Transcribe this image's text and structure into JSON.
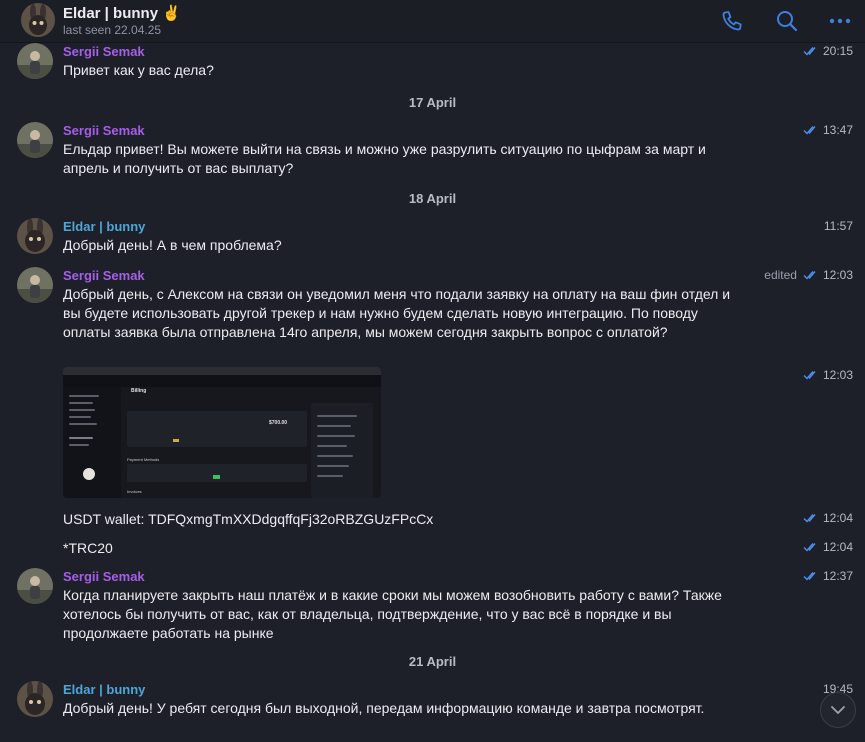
{
  "header": {
    "title": "Eldar | bunny ✌",
    "subtitle": "last seen 22.04.25",
    "icons": [
      "phone-icon",
      "search-icon",
      "more-icon"
    ]
  },
  "colors": {
    "accent": "#3d7fe0",
    "sergii": "#a55ee8",
    "eldar": "#4ea6d6",
    "background": "#1e2029"
  },
  "messages": [
    {
      "sender": "Sergii Semak",
      "text": "Привет как у вас дела?",
      "time": "20:15"
    },
    {
      "sender": "Sergii Semak",
      "text": "Ельдар привет! Вы можете выйти на связь и можно уже разрулить ситуацию по цыфрам за март и апрель и получить от вас выплату?",
      "time": "13:47"
    },
    {
      "sender": "Eldar | bunny",
      "text": "Добрый день! А в чем проблема?",
      "time": "11:57"
    },
    {
      "sender": "Sergii Semak",
      "text": "Добрый день, с Алексом на связи он уведомил меня что подали заявку на оплату на ваш фин отдел и вы будете использовать другой трекер и нам нужно будем сделать новую интеграцию. По поводу оплаты заявка была отправлена 14го апреля, мы можем сегодня закрыть вопрос с оплатой?",
      "time": "12:03",
      "edited": "edited"
    },
    {
      "image_time": "12:03",
      "image_text": {
        "page_title": "Billing",
        "balance": "$700.00",
        "payment_methods": "Payment Methods",
        "invoices": "Invoices"
      }
    },
    {
      "text": "USDT wallet: TDFQxmgTmXXDdgqffqFj32oRBZGUzFPcCx",
      "time": "12:04"
    },
    {
      "text": "*TRC20",
      "time": "12:04"
    },
    {
      "sender": "Sergii Semak",
      "text": "Когда планируете закрыть наш платёж и в какие сроки мы можем возобновить работу с вами? Также хотелось бы получить от вас, как от владельца, подтверждение, что у вас всё в порядке и вы продолжаете работать на рынке",
      "time": "12:37"
    },
    {
      "sender": "Eldar | bunny",
      "text": "Добрый день! У ребят сегодня был выходной, передам информацию команде и завтра посмотрят.",
      "time": "19:45"
    }
  ],
  "dates": [
    "17 April",
    "18 April",
    "21 April"
  ]
}
